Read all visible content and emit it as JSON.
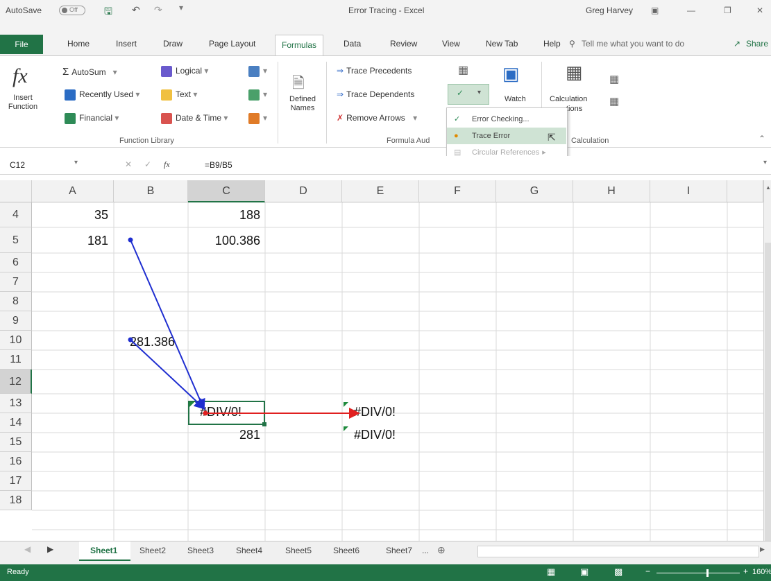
{
  "titlebar": {
    "autosave_label": "AutoSave",
    "autosave_state": "Off",
    "doc_title": "Error Tracing  -  Excel",
    "user": "Greg Harvey"
  },
  "tabs": [
    "File",
    "Home",
    "Insert",
    "Draw",
    "Page Layout",
    "Formulas",
    "Data",
    "Review",
    "View",
    "New Tab",
    "Help"
  ],
  "tell_me": "Tell me what you want to do",
  "share": "Share",
  "ribbon": {
    "insert_function": "Insert Function",
    "autosum": "AutoSum",
    "recently_used": "Recently Used",
    "financial": "Financial",
    "logical": "Logical",
    "text": "Text",
    "date_time": "Date & Time",
    "function_library": "Function Library",
    "defined_names": "Defined Names",
    "trace_precedents": "Trace Precedents",
    "trace_dependents": "Trace Dependents",
    "remove_arrows": "Remove Arrows",
    "formula_auditing": "Formula Aud",
    "watch": "Watch",
    "calculation_options": "Calculation",
    "calculation_options_2": "tions",
    "calculation": "Calculation"
  },
  "dropdown": {
    "error_checking": "Error Checking...",
    "trace_error": "Trace Error",
    "circular_refs": "Circular References"
  },
  "formula_bar": {
    "name_box": "C12",
    "formula": "=B9/B5"
  },
  "columns": [
    "A",
    "B",
    "C",
    "D",
    "E",
    "F",
    "G",
    "H",
    "I"
  ],
  "rows": [
    "4",
    "5",
    "6",
    "7",
    "8",
    "9",
    "10",
    "11",
    "12",
    "13",
    "14",
    "15",
    "16",
    "17",
    "18"
  ],
  "cells": {
    "A4": "35",
    "C4": "188",
    "A5": "181",
    "C5": "100.386",
    "B9": "281.386",
    "C12": "#DIV/0!",
    "E12": "#DIV/0!",
    "C13": "281",
    "E13": "#DIV/0!"
  },
  "sheets": [
    "Sheet1",
    "Sheet2",
    "Sheet3",
    "Sheet4",
    "Sheet5",
    "Sheet6",
    "Sheet7"
  ],
  "ellipsis": "...",
  "status": {
    "ready": "Ready",
    "zoom": "160%"
  },
  "colors": {
    "excel_green": "#217346",
    "precedent_arrow": "#1f2ed0",
    "error_arrow": "#e02020"
  }
}
